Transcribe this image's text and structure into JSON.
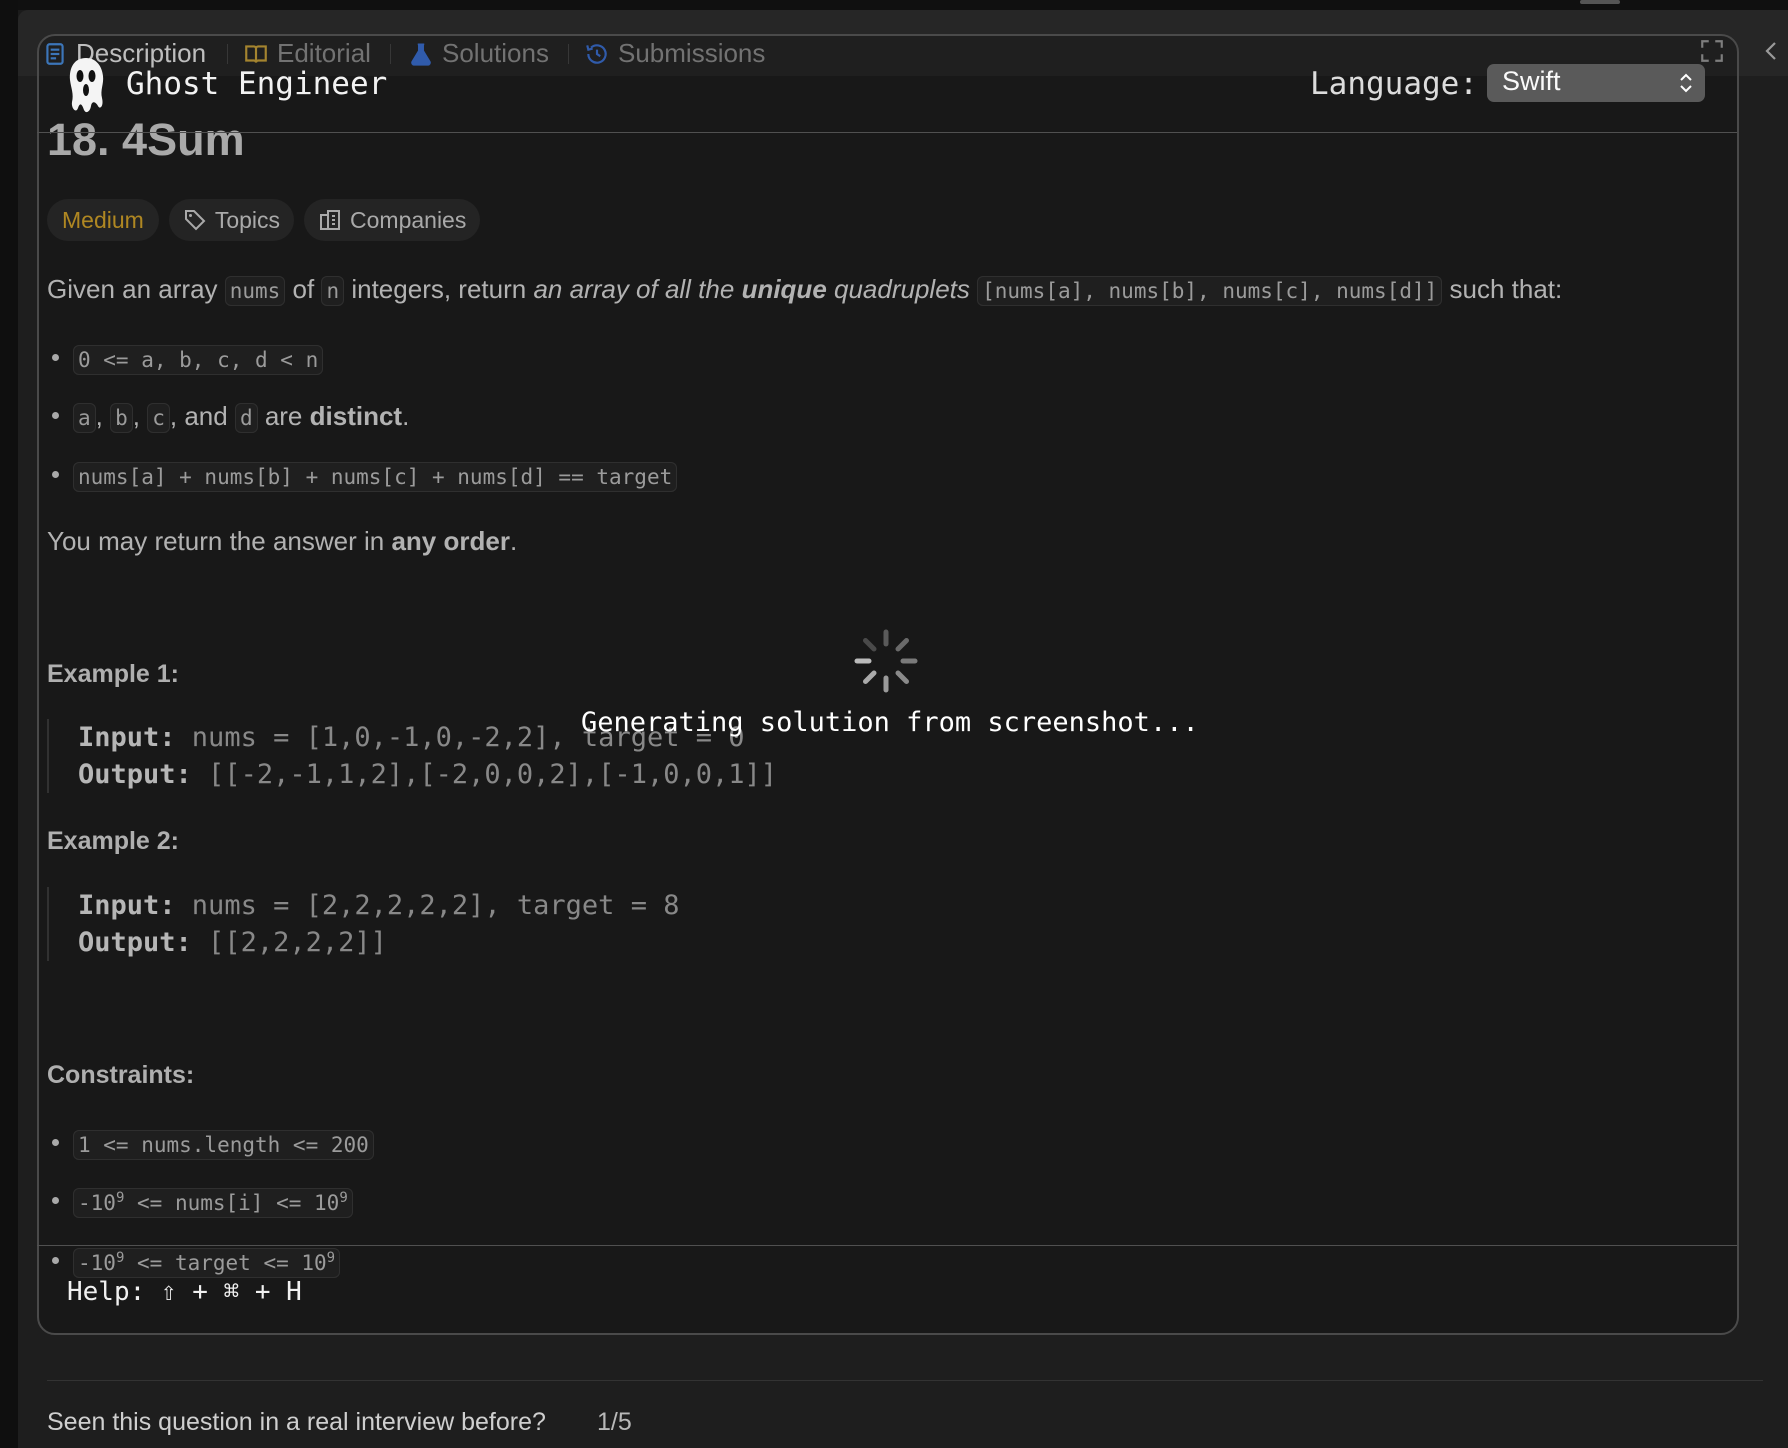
{
  "tabs": [
    {
      "label": "Description",
      "icon": "description-icon",
      "active": true
    },
    {
      "label": "Editorial",
      "icon": "book-icon",
      "active": false
    },
    {
      "label": "Solutions",
      "icon": "flask-icon",
      "active": false
    },
    {
      "label": "Submissions",
      "icon": "history-icon",
      "active": false
    }
  ],
  "overlay": {
    "app_name": "Ghost Engineer",
    "language_label": "Language:",
    "language_value": "Swift",
    "status": "Generating solution from screenshot...",
    "help": "Help: ⇧ + ⌘ + H"
  },
  "problem": {
    "title": "18. 4Sum",
    "difficulty": "Medium",
    "difficulty_color": "#d6a52a",
    "topics_label": "Topics",
    "companies_label": "Companies",
    "desc": {
      "t1": "Given an array ",
      "c1": "nums",
      "t2": " of ",
      "c2": "n",
      "t3": " integers, return ",
      "e1": "an array of all the ",
      "b1": "unique",
      "e2": " quadruplets ",
      "c3": "[nums[a], nums[b], nums[c], nums[d]]",
      "t4": " such that:"
    },
    "bullets": {
      "b1_code": "0 <= a, b, c, d < n",
      "b2_a": "a",
      "b2_s1": ", ",
      "b2_b": "b",
      "b2_s2": ", ",
      "b2_c": "c",
      "b2_s3": ", and ",
      "b2_d": "d",
      "b2_s4": " are ",
      "b2_bold": "distinct",
      "b2_end": ".",
      "b3_code": "nums[a] + nums[b] + nums[c] + nums[d] == target"
    },
    "order": {
      "t1": "You may return the answer in ",
      "b": "any order",
      "t2": "."
    },
    "example1": {
      "title": "Example 1:",
      "input_label": "Input:",
      "input": " nums = [1,0,-1,0,-2,2], target = 0",
      "output_label": "Output:",
      "output": " [[-2,-1,1,2],[-2,0,0,2],[-1,0,0,1]]"
    },
    "example2": {
      "title": "Example 2:",
      "input_label": "Input:",
      "input": " nums = [2,2,2,2,2], target = 8",
      "output_label": "Output:",
      "output": " [[2,2,2,2]]"
    },
    "constraints_title": "Constraints:",
    "constraints": {
      "c1": "1 <= nums.length <= 200",
      "c2_a": "-10",
      "c2_sup1": "9",
      "c2_b": " <= nums[i] <= 10",
      "c2_sup2": "9",
      "c3_a": "-10",
      "c3_sup1": "9",
      "c3_b": " <= target <= 10",
      "c3_sup2": "9"
    }
  },
  "bottom": {
    "question": "Seen this question in a real interview before?",
    "count": "1/5"
  }
}
